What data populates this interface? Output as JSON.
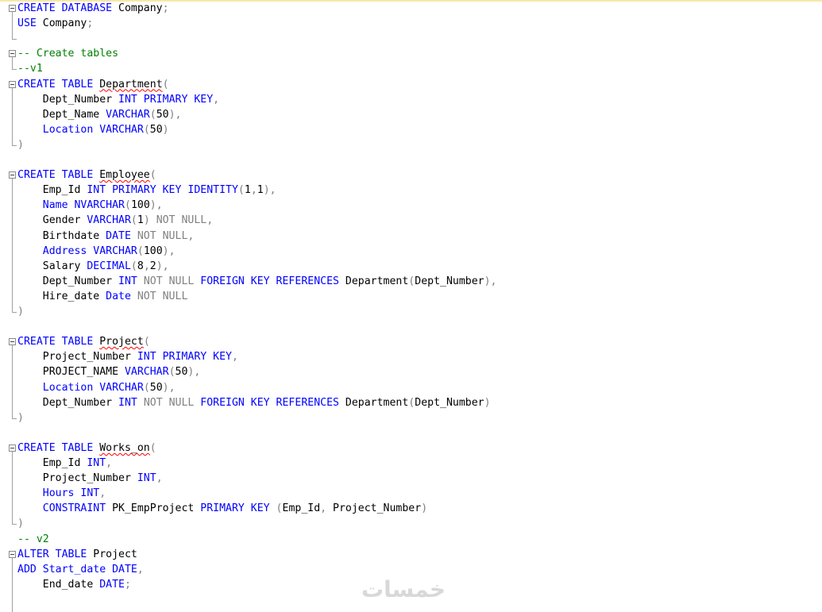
{
  "editor": {
    "colors": {
      "keyword": "#0000ff",
      "operator": "#808080",
      "comment": "#008000",
      "text": "#000000",
      "error_squiggle": "#ff0000"
    },
    "lines": [
      {
        "fold": "start",
        "tokens": [
          {
            "t": "CREATE DATABASE",
            "c": "kw"
          },
          {
            "t": " Company"
          },
          {
            "t": ";",
            "c": "op"
          }
        ]
      },
      {
        "tokens": [
          {
            "t": "USE",
            "c": "kw"
          },
          {
            "t": " Company"
          },
          {
            "t": ";",
            "c": "op"
          }
        ]
      },
      {
        "tokens": []
      },
      {
        "fold": "start",
        "tokens": [
          {
            "t": "-- Create tables",
            "c": "cm"
          }
        ]
      },
      {
        "tokens": [
          {
            "t": "--v1",
            "c": "cm"
          }
        ]
      },
      {
        "fold": "start",
        "tokens": [
          {
            "t": "CREATE TABLE",
            "c": "kw"
          },
          {
            "t": " "
          },
          {
            "t": "Department",
            "err": true
          },
          {
            "t": "(",
            "c": "op"
          }
        ]
      },
      {
        "tokens": [
          {
            "t": "    Dept_Number "
          },
          {
            "t": "INT PRIMARY KEY",
            "c": "kw"
          },
          {
            "t": ",",
            "c": "op"
          }
        ]
      },
      {
        "tokens": [
          {
            "t": "    Dept_Name "
          },
          {
            "t": "VARCHAR",
            "c": "kw"
          },
          {
            "t": "(",
            "c": "op"
          },
          {
            "t": "50"
          },
          {
            "t": "),",
            "c": "op"
          }
        ]
      },
      {
        "tokens": [
          {
            "t": "    "
          },
          {
            "t": "Location VARCHAR",
            "c": "kw"
          },
          {
            "t": "(",
            "c": "op"
          },
          {
            "t": "50"
          },
          {
            "t": ")",
            "c": "op"
          }
        ]
      },
      {
        "fold": "end",
        "tokens": [
          {
            "t": ")",
            "c": "op"
          }
        ]
      },
      {
        "tokens": []
      },
      {
        "fold": "start",
        "tokens": [
          {
            "t": "CREATE TABLE",
            "c": "kw"
          },
          {
            "t": " "
          },
          {
            "t": "Employee",
            "err": true
          },
          {
            "t": "(",
            "c": "op"
          }
        ]
      },
      {
        "tokens": [
          {
            "t": "    Emp_Id "
          },
          {
            "t": "INT PRIMARY KEY IDENTITY",
            "c": "kw"
          },
          {
            "t": "(",
            "c": "op"
          },
          {
            "t": "1"
          },
          {
            "t": ",",
            "c": "op"
          },
          {
            "t": "1"
          },
          {
            "t": "),",
            "c": "op"
          }
        ]
      },
      {
        "tokens": [
          {
            "t": "    "
          },
          {
            "t": "Name NVARCHAR",
            "c": "kw"
          },
          {
            "t": "(",
            "c": "op"
          },
          {
            "t": "100"
          },
          {
            "t": "),",
            "c": "op"
          }
        ]
      },
      {
        "tokens": [
          {
            "t": "    Gender "
          },
          {
            "t": "VARCHAR",
            "c": "kw"
          },
          {
            "t": "(",
            "c": "op"
          },
          {
            "t": "1"
          },
          {
            "t": ") NOT NULL,",
            "c": "op"
          }
        ]
      },
      {
        "tokens": [
          {
            "t": "    Birthdate "
          },
          {
            "t": "DATE",
            "c": "kw"
          },
          {
            "t": " NOT NULL,",
            "c": "op"
          }
        ]
      },
      {
        "tokens": [
          {
            "t": "    "
          },
          {
            "t": "Address VARCHAR",
            "c": "kw"
          },
          {
            "t": "(",
            "c": "op"
          },
          {
            "t": "100"
          },
          {
            "t": "),",
            "c": "op"
          }
        ]
      },
      {
        "tokens": [
          {
            "t": "    Salary "
          },
          {
            "t": "DECIMAL",
            "c": "kw"
          },
          {
            "t": "(",
            "c": "op"
          },
          {
            "t": "8"
          },
          {
            "t": ",",
            "c": "op"
          },
          {
            "t": "2"
          },
          {
            "t": "),",
            "c": "op"
          }
        ]
      },
      {
        "tokens": [
          {
            "t": "    Dept_Number "
          },
          {
            "t": "INT",
            "c": "kw"
          },
          {
            "t": " NOT NULL ",
            "c": "op"
          },
          {
            "t": "FOREIGN KEY REFERENCES",
            "c": "kw"
          },
          {
            "t": " Department"
          },
          {
            "t": "(",
            "c": "op"
          },
          {
            "t": "Dept_Number"
          },
          {
            "t": "),",
            "c": "op"
          }
        ]
      },
      {
        "tokens": [
          {
            "t": "    Hire_date "
          },
          {
            "t": "Date",
            "c": "kw"
          },
          {
            "t": " NOT NULL",
            "c": "op"
          }
        ]
      },
      {
        "fold": "end",
        "tokens": [
          {
            "t": ")",
            "c": "op"
          }
        ]
      },
      {
        "tokens": []
      },
      {
        "fold": "start",
        "tokens": [
          {
            "t": "CREATE TABLE",
            "c": "kw"
          },
          {
            "t": " "
          },
          {
            "t": "Project",
            "err": true
          },
          {
            "t": "(",
            "c": "op"
          }
        ]
      },
      {
        "tokens": [
          {
            "t": "    Project_Number "
          },
          {
            "t": "INT PRIMARY KEY",
            "c": "kw"
          },
          {
            "t": ",",
            "c": "op"
          }
        ]
      },
      {
        "tokens": [
          {
            "t": "    PROJECT_NAME "
          },
          {
            "t": "VARCHAR",
            "c": "kw"
          },
          {
            "t": "(",
            "c": "op"
          },
          {
            "t": "50"
          },
          {
            "t": "),",
            "c": "op"
          }
        ]
      },
      {
        "tokens": [
          {
            "t": "    "
          },
          {
            "t": "Location VARCHAR",
            "c": "kw"
          },
          {
            "t": "(",
            "c": "op"
          },
          {
            "t": "50"
          },
          {
            "t": "),",
            "c": "op"
          }
        ]
      },
      {
        "tokens": [
          {
            "t": "    Dept_Number "
          },
          {
            "t": "INT",
            "c": "kw"
          },
          {
            "t": " NOT NULL ",
            "c": "op"
          },
          {
            "t": "FOREIGN KEY REFERENCES",
            "c": "kw"
          },
          {
            "t": " Department"
          },
          {
            "t": "(",
            "c": "op"
          },
          {
            "t": "Dept_Number"
          },
          {
            "t": ")",
            "c": "op"
          }
        ]
      },
      {
        "fold": "end",
        "tokens": [
          {
            "t": ")",
            "c": "op"
          }
        ]
      },
      {
        "tokens": []
      },
      {
        "fold": "start",
        "tokens": [
          {
            "t": "CREATE TABLE",
            "c": "kw"
          },
          {
            "t": " "
          },
          {
            "t": "Works_on",
            "err": true
          },
          {
            "t": "(",
            "c": "op"
          }
        ]
      },
      {
        "tokens": [
          {
            "t": "    Emp_Id "
          },
          {
            "t": "INT",
            "c": "kw"
          },
          {
            "t": ",",
            "c": "op"
          }
        ]
      },
      {
        "tokens": [
          {
            "t": "    Project_Number "
          },
          {
            "t": "INT",
            "c": "kw"
          },
          {
            "t": ",",
            "c": "op"
          }
        ]
      },
      {
        "tokens": [
          {
            "t": "    "
          },
          {
            "t": "Hours INT",
            "c": "kw"
          },
          {
            "t": ",",
            "c": "op"
          }
        ]
      },
      {
        "tokens": [
          {
            "t": "    "
          },
          {
            "t": "CONSTRAINT",
            "c": "kw"
          },
          {
            "t": " PK_EmpProject "
          },
          {
            "t": "PRIMARY KEY",
            "c": "kw"
          },
          {
            "t": " (",
            "c": "op"
          },
          {
            "t": "Emp_Id"
          },
          {
            "t": ",",
            "c": "op"
          },
          {
            "t": " Project_Number"
          },
          {
            "t": ")",
            "c": "op"
          }
        ]
      },
      {
        "fold": "end",
        "tokens": [
          {
            "t": ")",
            "c": "op"
          }
        ]
      },
      {
        "tokens": [
          {
            "t": "-- v2",
            "c": "cm"
          }
        ]
      },
      {
        "fold": "start",
        "tokens": [
          {
            "t": "ALTER TABLE",
            "c": "kw"
          },
          {
            "t": " Project"
          }
        ]
      },
      {
        "tokens": [
          {
            "t": "ADD",
            "c": "kw"
          },
          {
            "t": " "
          },
          {
            "t": "Start_date DATE",
            "c": "kw"
          },
          {
            "t": ",",
            "c": "op"
          }
        ]
      },
      {
        "tokens": [
          {
            "t": "    End_date "
          },
          {
            "t": "DATE",
            "c": "kw"
          },
          {
            "t": ";",
            "c": "op"
          }
        ]
      },
      {
        "tokens": []
      }
    ]
  },
  "watermark": {
    "text": "خمسات"
  }
}
